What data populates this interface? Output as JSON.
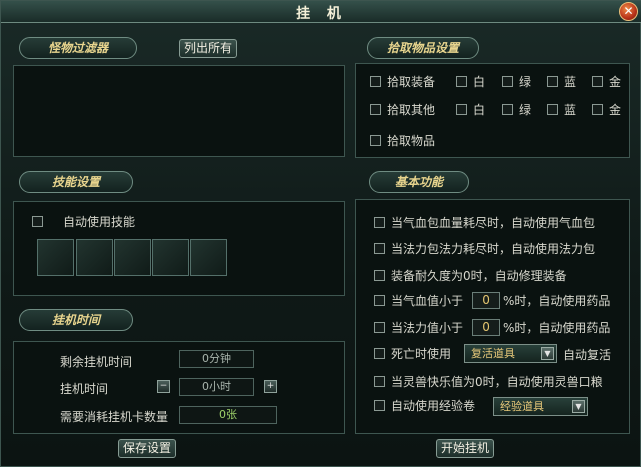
{
  "window": {
    "title": "挂 机",
    "close_symbol": "✕"
  },
  "monster_filter": {
    "badge": "怪物过滤器",
    "list_all_button": "列出所有"
  },
  "pickup": {
    "badge": "拾取物品设置",
    "rows": [
      {
        "label": "拾取装备",
        "white": "白",
        "green": "绿",
        "blue": "蓝",
        "gold": "金"
      },
      {
        "label": "拾取其他",
        "white": "白",
        "green": "绿",
        "blue": "蓝",
        "gold": "金"
      }
    ],
    "pickup_items_label": "拾取物品"
  },
  "skills": {
    "badge": "技能设置",
    "auto_use_label": "自动使用技能",
    "slots": [
      "",
      "",
      "",
      "",
      ""
    ]
  },
  "basic": {
    "badge": "基本功能",
    "option1": "当气血包血量耗尽时，自动使用气血包",
    "option2": "当法力包法力耗尽时，自动使用法力包",
    "option3": "装备耐久度为0时，自动修理装备",
    "hp_prefix": "当气血值小于",
    "hp_value": "0",
    "hp_suffix": "%时，自动使用药品",
    "mp_prefix": "当法力值小于",
    "mp_value": "0",
    "mp_suffix": "%时，自动使用药品",
    "death_label": "死亡时使用",
    "death_select": "复活道具",
    "death_suffix": "自动复活",
    "pet_label": "当灵兽快乐值为0时，自动使用灵兽口粮",
    "exp_label": "自动使用经验卷",
    "exp_select": "经验道具"
  },
  "afk_time": {
    "badge": "挂机时间",
    "remaining_label": "剩余挂机时间",
    "remaining_value": "0分钟",
    "time_label": "挂机时间",
    "time_value": "0小时",
    "card_label": "需要消耗挂机卡数量",
    "card_value": "0张"
  },
  "footer": {
    "save_button": "保存设置",
    "start_button": "开始挂机"
  }
}
